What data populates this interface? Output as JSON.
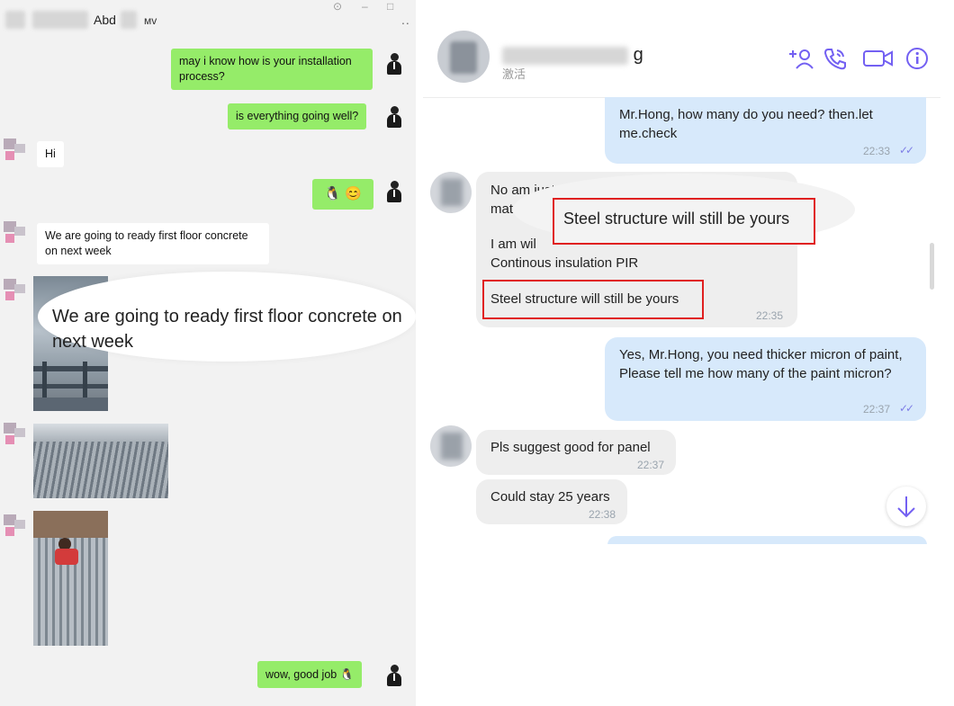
{
  "left": {
    "title_suffix": "Abd",
    "title_suffix2": "мv",
    "messages": {
      "m1": "may i know how is your installation process?",
      "m2": "is everything going well?",
      "m3": "Hi",
      "m4_emoji": "🐧 😊",
      "m5": "We are going to ready first floor concrete on next week",
      "m5_zoom": "We are going to ready first floor concrete on next week",
      "m6": "wow, good job",
      "m6_emoji": "🐧"
    }
  },
  "right": {
    "contact_name_suffix": "g",
    "contact_status": "激活",
    "messages": {
      "r1": "Mr.Hong, how many do you need? then.let me.check",
      "r1_time": "22:33",
      "r2_line1": "No am just co",
      "r2_line2": "materi",
      "r2_line3": "I am wil",
      "r2_line4": "Continous insulation PIR",
      "r2_highlight": "Steel structure will still be yours",
      "r2_zoom": "Steel structure will still be yours",
      "r2_time": "22:35",
      "r3": "Yes, Mr.Hong, you need thicker micron of paint, Please tell me how many of the paint micron?",
      "r3_time": "22:37",
      "r4": "Pls suggest good for panel",
      "r4_time": "22:37",
      "r5": "Could stay 25 years",
      "r5_time": "22:38"
    },
    "ticks": "✓✓"
  },
  "colors": {
    "wechat_green": "#95ec69",
    "viber_purple": "#7360f2",
    "highlight_red": "#e02020",
    "outgoing_blue": "#d7e9fb"
  }
}
